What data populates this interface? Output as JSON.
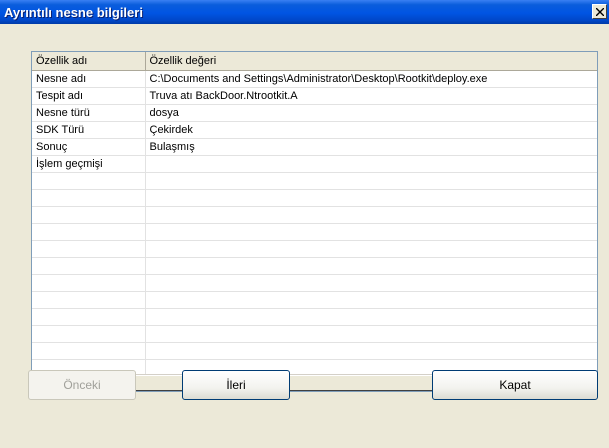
{
  "window": {
    "title": "Ayrıntılı nesne bilgileri",
    "close_glyph": "×"
  },
  "table": {
    "headers": [
      "Özellik adı",
      "Özellik değeri"
    ],
    "rows": [
      [
        "Nesne adı",
        "C:\\Documents and Settings\\Administrator\\Desktop\\Rootkit\\deploy.exe"
      ],
      [
        "Tespit adı",
        "Truva atı BackDoor.Ntrootkit.A"
      ],
      [
        "Nesne türü",
        "dosya"
      ],
      [
        "SDK Türü",
        "Çekirdek"
      ],
      [
        "Sonuç",
        "Bulaşmış"
      ],
      [
        "İşlem geçmişi",
        ""
      ],
      [
        "",
        ""
      ],
      [
        "",
        ""
      ],
      [
        "",
        ""
      ],
      [
        "",
        ""
      ],
      [
        "",
        ""
      ],
      [
        "",
        ""
      ],
      [
        "",
        ""
      ],
      [
        "",
        ""
      ],
      [
        "",
        ""
      ],
      [
        "",
        ""
      ],
      [
        "",
        ""
      ],
      [
        "",
        ""
      ]
    ]
  },
  "buttons": {
    "previous": "Önceki",
    "next": "İleri",
    "close": "Kapat"
  },
  "colors": {
    "titlebar": "#0054e3",
    "dialog_bg": "#ece9d8",
    "grid_border": "#7f9db9",
    "button_border": "#003c74"
  }
}
